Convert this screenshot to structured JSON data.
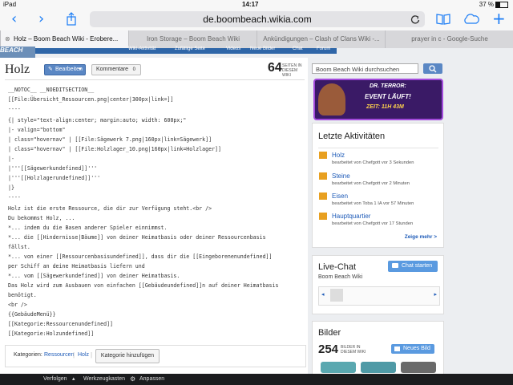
{
  "status": {
    "device": "iPad",
    "time": "14:17",
    "battery": "37 %"
  },
  "browser": {
    "url": "de.boombeach.wikia.com",
    "tabs": [
      {
        "label": "Holz – Boom Beach Wiki - Erobere..."
      },
      {
        "label": "Iron Storage – Boom Beach Wiki"
      },
      {
        "label": "Ankündigungen – Clash of Clans Wiki -..."
      },
      {
        "label": "prayer in c - Google-Suche"
      }
    ]
  },
  "page": {
    "title": "Holz",
    "edit_label": "Bearbeiten",
    "comments_label": "Kommentare",
    "comments_count": "0",
    "page_count": "64",
    "page_count_label": "SEITEN IN DIESEM WIKI",
    "wikitext": [
      "__NOTOC__ __NOEDITSECTION__",
      "[[File:Übersicht_Ressourcen.png|center|300px|link=]]",
      "----",
      "{| style=\"text-align:center; margin:auto; width: 600px;\"",
      "|- valign=\"bottom\"",
      "| class=\"hovernav\" | [[File:Sägewerk 7.png|160px|link=Sägewerk]]",
      "| class=\"hovernav\" | [[File:Holzlager_10.png|160px|link=Holzlager]]",
      "|-",
      "|'''[[Sägewerkundefined]]'''",
      "|'''[[Holzlagerundefined]]'''",
      "|}",
      "----",
      "Holz ist die erste Ressource, die dir zur Verfügung steht.<br />",
      "Du bekommst Holz, ...",
      "*... indem du die Basen anderer Spieler einnimmst.",
      "*... die [[Hindernisse|Bäume]] von deiner Heimatbasis oder deiner Ressourcenbasis",
      "fällst.",
      "*... von einer [[Ressourcenbasisundefined]], dass dir die [[Eingeborenenundefined]]",
      "per Schiff an deine Heimatbasis liefern und",
      "*... vom [[Sägewerkundefined]] von deiner Heimatbasis.",
      "Das Holz wird zum Ausbauen von einfachen [[Gebäudeundefined]]n auf deiner Heimatbasis",
      "benötigt.",
      "<br />",
      "{{GebäudeMenü}}",
      "[[Kategorie:Ressourcenundefined]]",
      "[[Kategorie:Holzundefined]]"
    ],
    "categories_label": "Kategorien:",
    "categories": [
      "Ressourcen",
      "Holz"
    ],
    "add_category_label": "Kategorie hinzufügen",
    "site_nav": [
      "Wiki-Aktivität",
      "Zufällige Seite",
      "Videos",
      "Neue Bilder",
      "Chat",
      "Forum"
    ],
    "logo": "BEACH"
  },
  "sidebar": {
    "search_placeholder": "Boom Beach Wiki durchsuchen",
    "banner": {
      "line1": "DR. TERROR:",
      "line2": "EVENT LÄUFT!",
      "line3": "ZEIT: 11H 43M"
    },
    "activity": {
      "title": "Letzte Aktivitäten",
      "items": [
        {
          "page": "Holz",
          "meta": "bearbeitet von Chefgott vor 3 Sekunden"
        },
        {
          "page": "Steine",
          "meta": "bearbeitet von Chefgott vor 2 Minuten"
        },
        {
          "page": "Eisen",
          "meta": "bearbeitet von Toba 1 IA vor 57 Minuten"
        },
        {
          "page": "Hauptquartier",
          "meta": "bearbeitet von Chefgott vor 17 Stunden"
        }
      ],
      "more": "Zeige mehr >"
    },
    "chat": {
      "title": "Live-Chat",
      "subtitle": "Boom Beach Wiki",
      "start_label": "Chat starten"
    },
    "images": {
      "title": "Bilder",
      "count": "254",
      "count_label": "BILDER IN DIESEM WIKI",
      "new_label": "Neues Bild"
    }
  },
  "bottom_toolbar": {
    "items": [
      "Verfolgen",
      "Werkzeugkasten",
      "Anpassen"
    ]
  }
}
